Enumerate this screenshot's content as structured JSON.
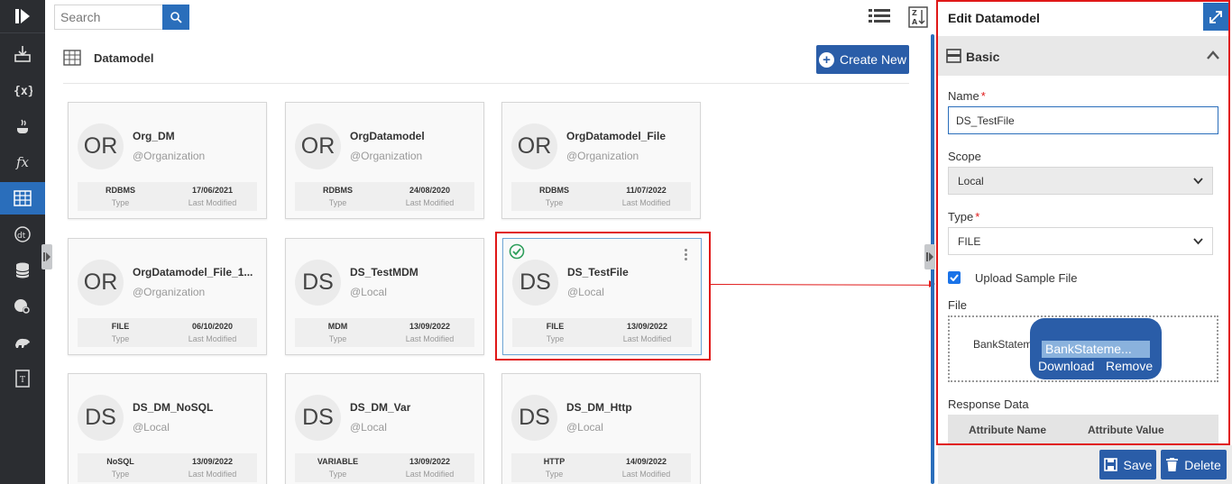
{
  "search": {
    "placeholder": "Search"
  },
  "page": {
    "title": "Datamodel",
    "create_label": "Create New"
  },
  "sidebar": {
    "items": [
      {
        "icon": "import-icon"
      },
      {
        "icon": "variable-icon"
      },
      {
        "icon": "java-icon"
      },
      {
        "icon": "function-icon"
      },
      {
        "icon": "datamodel-icon",
        "active": true
      },
      {
        "icon": "datatype-icon"
      },
      {
        "icon": "database-icon"
      },
      {
        "icon": "settings-globe-icon"
      },
      {
        "icon": "hadoop-icon"
      },
      {
        "icon": "template-icon"
      }
    ]
  },
  "cards": [
    {
      "initials": "OR",
      "name": "Org_DM",
      "scope": "@Organization",
      "type": "RDBMS",
      "type_label": "Type",
      "date": "17/06/2021",
      "date_label": "Last Modified"
    },
    {
      "initials": "OR",
      "name": "OrgDatamodel",
      "scope": "@Organization",
      "type": "RDBMS",
      "type_label": "Type",
      "date": "24/08/2020",
      "date_label": "Last Modified"
    },
    {
      "initials": "OR",
      "name": "OrgDatamodel_File",
      "scope": "@Organization",
      "type": "RDBMS",
      "type_label": "Type",
      "date": "11/07/2022",
      "date_label": "Last Modified"
    },
    {
      "initials": "OR",
      "name": "OrgDatamodel_File_1...",
      "scope": "@Organization",
      "type": "FILE",
      "type_label": "Type",
      "date": "06/10/2020",
      "date_label": "Last Modified"
    },
    {
      "initials": "DS",
      "name": "DS_TestMDM",
      "scope": "@Local",
      "type": "MDM",
      "type_label": "Type",
      "date": "13/09/2022",
      "date_label": "Last Modified"
    },
    {
      "initials": "DS",
      "name": "DS_TestFile",
      "scope": "@Local",
      "type": "FILE",
      "type_label": "Type",
      "date": "13/09/2022",
      "date_label": "Last Modified"
    },
    {
      "initials": "DS",
      "name": "DS_DM_NoSQL",
      "scope": "@Local",
      "type": "NoSQL",
      "type_label": "Type",
      "date": "13/09/2022",
      "date_label": "Last Modified"
    },
    {
      "initials": "DS",
      "name": "DS_DM_Var",
      "scope": "@Local",
      "type": "VARIABLE",
      "type_label": "Type",
      "date": "13/09/2022",
      "date_label": "Last Modified"
    },
    {
      "initials": "DS",
      "name": "DS_DM_Http",
      "scope": "@Local",
      "type": "HTTP",
      "type_label": "Type",
      "date": "14/09/2022",
      "date_label": "Last Modified"
    }
  ],
  "panel": {
    "title": "Edit Datamodel",
    "section": "Basic",
    "name_label": "Name",
    "name_value": "DS_TestFile",
    "scope_label": "Scope",
    "scope_value": "Local",
    "type_label": "Type",
    "type_value": "FILE",
    "upload_label": "Upload Sample File",
    "upload_checked": true,
    "file_label": "File",
    "file_name": "BankStatement",
    "file_popup_name": "BankStateme...",
    "download_label": "Download",
    "remove_label": "Remove",
    "response_label": "Response Data",
    "col_attr_name": "Attribute Name",
    "col_attr_value": "Attribute Value",
    "save_label": "Save",
    "delete_label": "Delete"
  },
  "colors": {
    "accent": "#2a6ebb",
    "button": "#2a5da8",
    "highlight": "#e01818",
    "rail": "#2b2d31"
  }
}
